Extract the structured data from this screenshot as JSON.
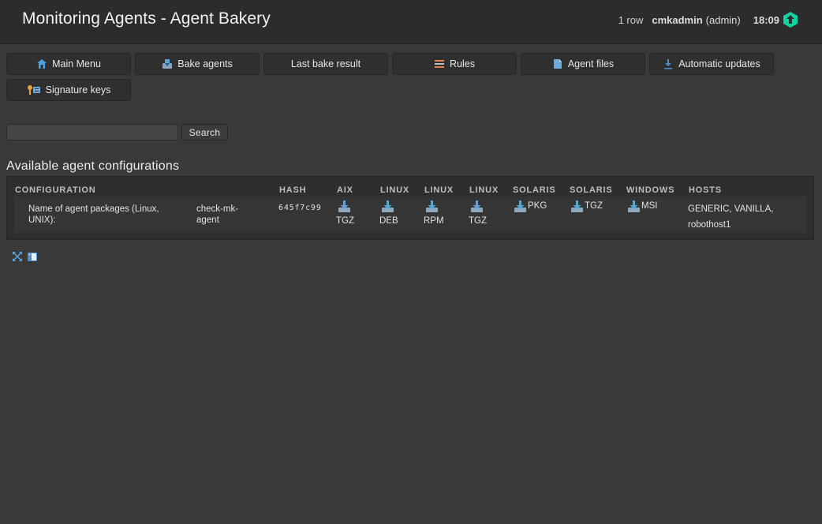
{
  "header": {
    "title": "Monitoring Agents - Agent Bakery",
    "row_count": "1 row",
    "user": "cmkadmin",
    "role": "(admin)",
    "time": "18:09"
  },
  "toolbar": {
    "main_menu": "Main Menu",
    "bake_agents": "Bake agents",
    "last_bake_result": "Last bake result",
    "rules": "Rules",
    "agent_files": "Agent files",
    "automatic_updates": "Automatic updates",
    "signature_keys": "Signature keys"
  },
  "search": {
    "value": "",
    "placeholder": "",
    "button_label": "Search"
  },
  "section": {
    "title": "Available agent configurations"
  },
  "table": {
    "columns": [
      "CONFIGURATION",
      "HASH",
      "AIX",
      "LINUX",
      "LINUX",
      "LINUX",
      "SOLARIS",
      "SOLARIS",
      "WINDOWS",
      "HOSTS"
    ],
    "row": {
      "config_name_line1": "Name of agent packages (Linux,",
      "config_name_line2": "UNIX):",
      "config_value_line1": "check-mk-",
      "config_value_line2": "agent",
      "hash": "645f7c99",
      "downloads": [
        "TGZ",
        "DEB",
        "RPM",
        "TGZ",
        "PKG",
        "TGZ",
        "MSI"
      ],
      "hosts_line1": "GENERIC, VANILLA,",
      "hosts_line2": "robothost1"
    }
  },
  "footer_icons": [
    "expand-icon",
    "reference-icon"
  ],
  "colors": {
    "background": "#393939",
    "topbar": "#2c2c2c",
    "accent": "#15d1a0",
    "download_icon": "#5aa6d8"
  }
}
